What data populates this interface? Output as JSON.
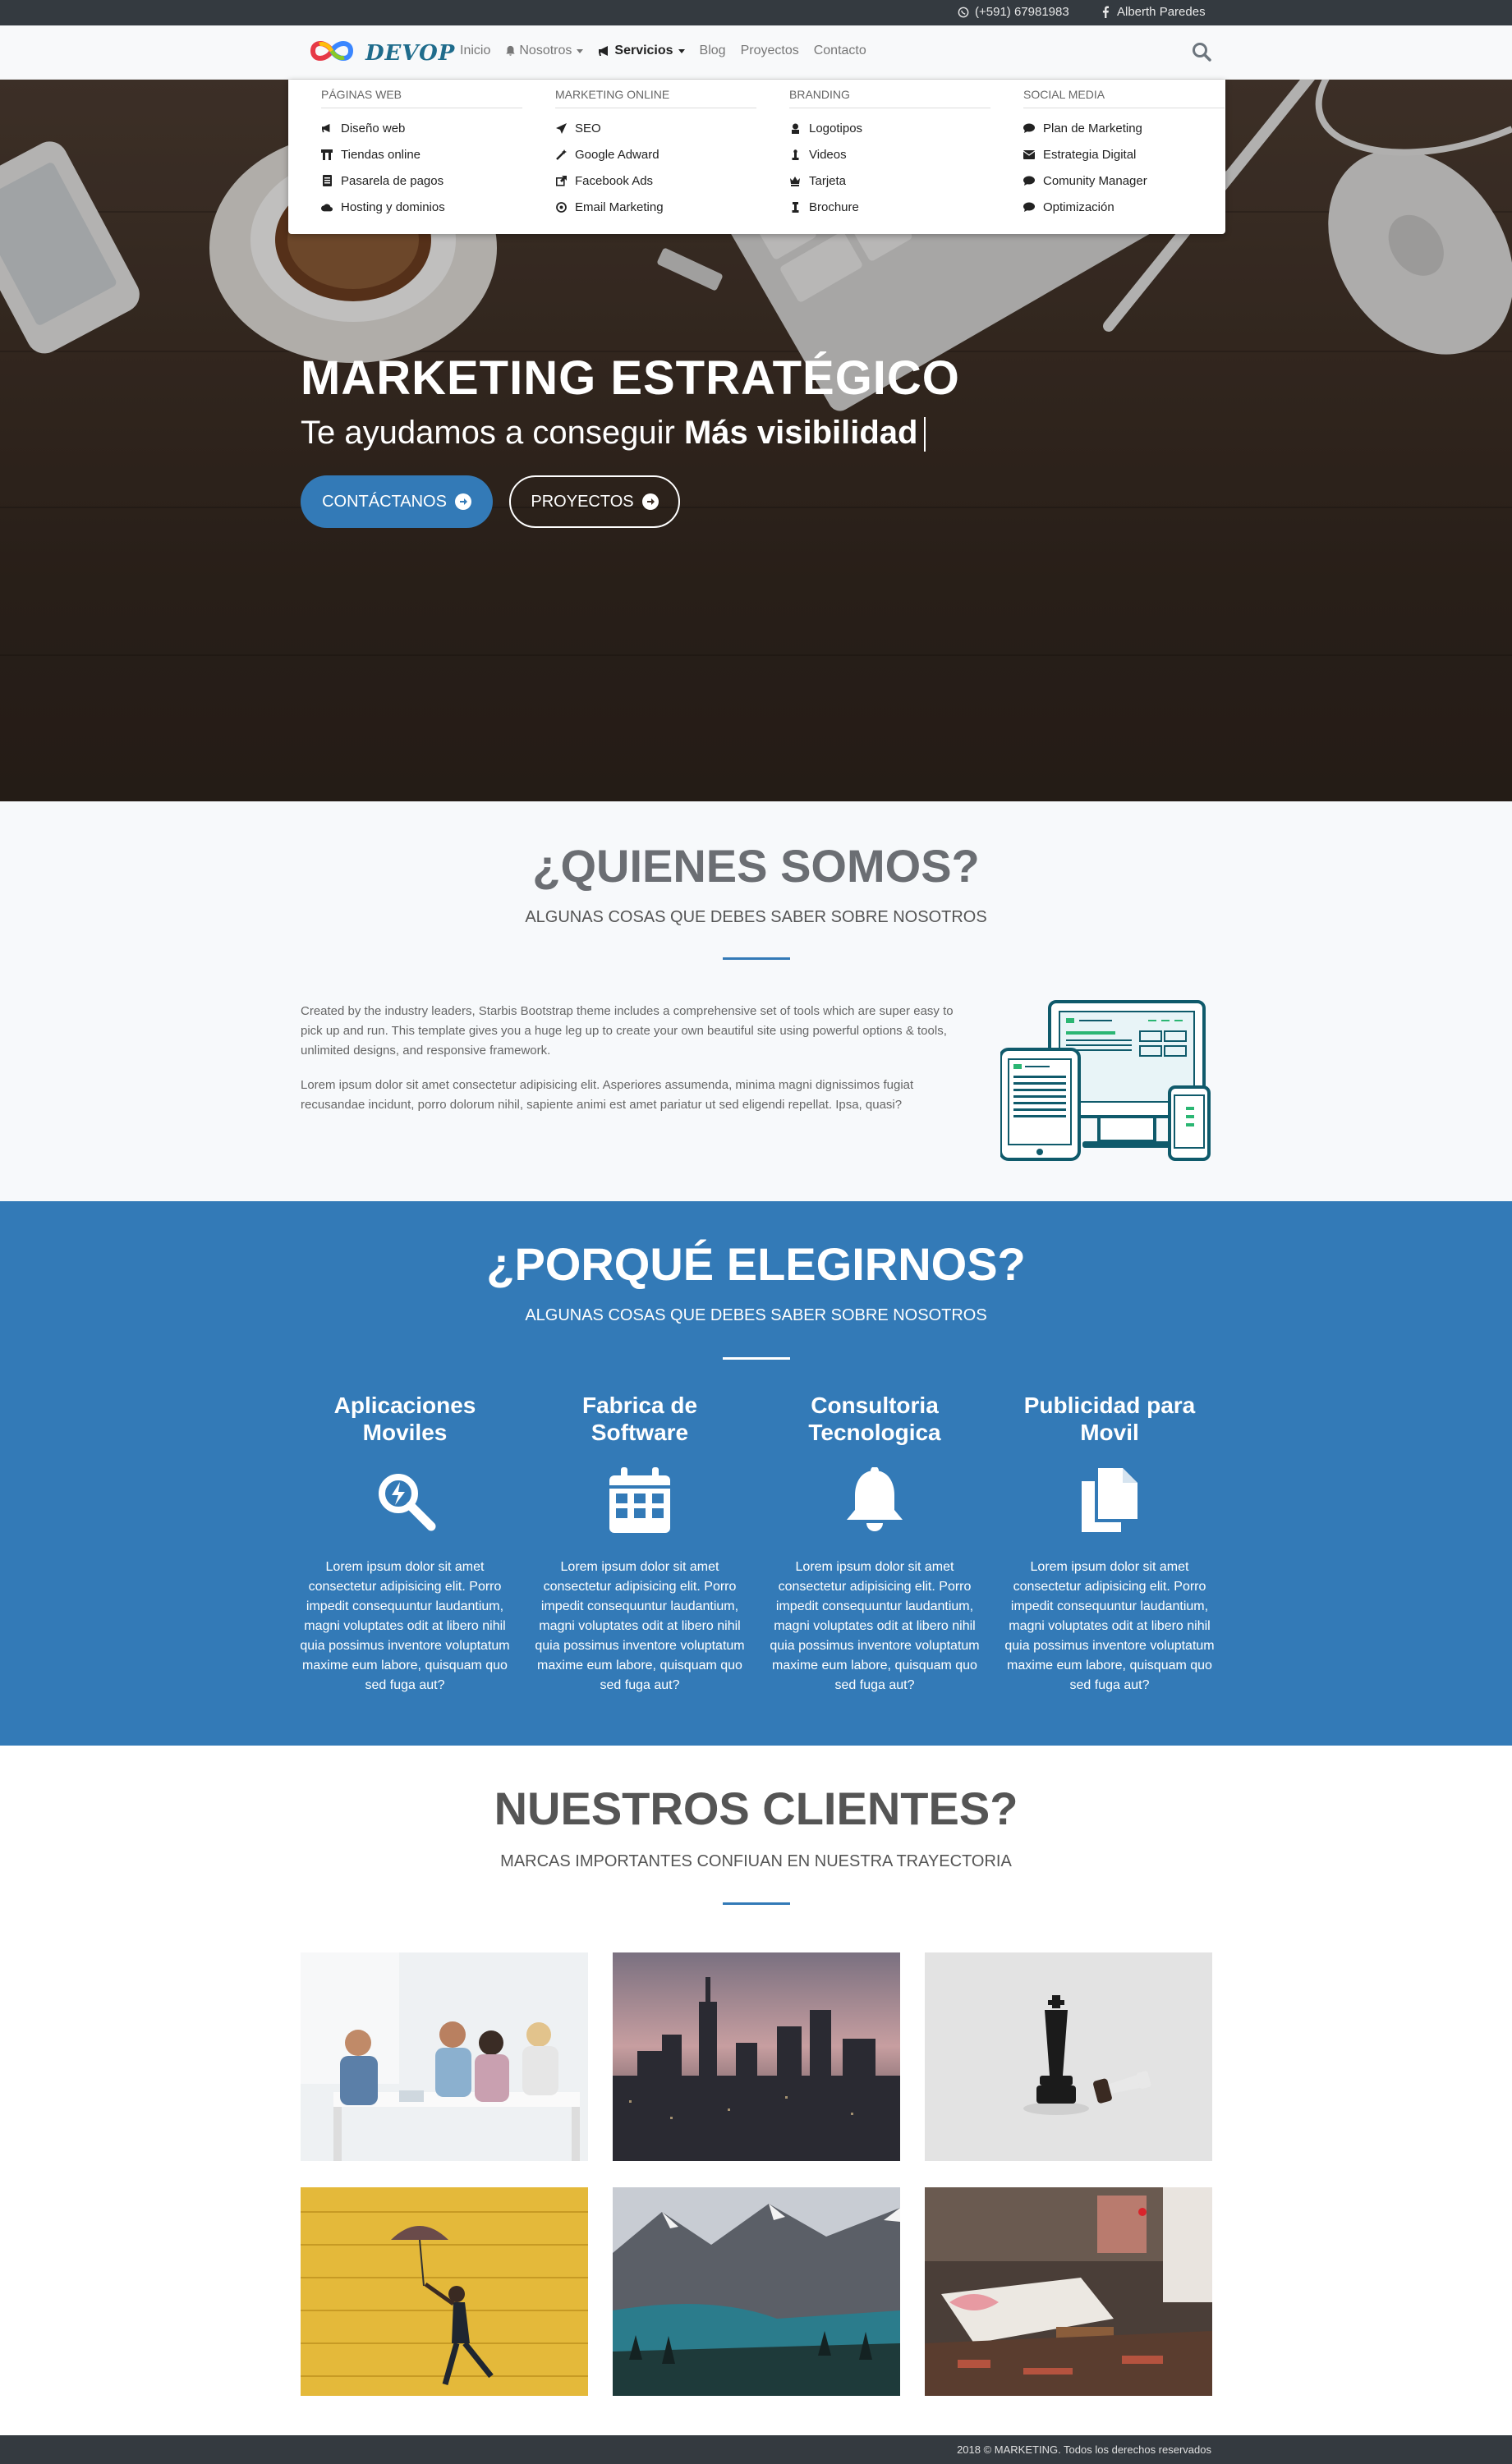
{
  "topbar": {
    "phone": "(+591) 67981983",
    "facebook_name": "Alberth Paredes"
  },
  "brand": {
    "name": "DEVOP"
  },
  "nav": {
    "items": [
      {
        "label": "Inicio",
        "dropdown": false,
        "icon": ""
      },
      {
        "label": "Nosotros",
        "dropdown": true,
        "icon": "bell-icon"
      },
      {
        "label": "Servicios",
        "dropdown": true,
        "icon": "bullhorn-icon",
        "active": true
      },
      {
        "label": "Blog",
        "dropdown": false,
        "icon": ""
      },
      {
        "label": "Proyectos",
        "dropdown": false,
        "icon": ""
      },
      {
        "label": "Contacto",
        "dropdown": false,
        "icon": ""
      }
    ]
  },
  "mega_menu": {
    "columns": [
      {
        "title": "PÁGINAS WEB",
        "items": [
          {
            "label": "Diseño web",
            "icon": "bullhorn-icon"
          },
          {
            "label": "Tiendas online",
            "icon": "store-icon"
          },
          {
            "label": "Pasarela de pagos",
            "icon": "receipt-icon"
          },
          {
            "label": "Hosting y dominios",
            "icon": "cloud-icon"
          }
        ]
      },
      {
        "title": "MARKETING ONLINE",
        "items": [
          {
            "label": "SEO",
            "icon": "send-icon"
          },
          {
            "label": "Google Adward",
            "icon": "magic-icon"
          },
          {
            "label": "Facebook Ads",
            "icon": "external-link-icon"
          },
          {
            "label": "Email Marketing",
            "icon": "at-icon"
          }
        ]
      },
      {
        "title": "BRANDING",
        "items": [
          {
            "label": "Logotipos",
            "icon": "hat-icon"
          },
          {
            "label": "Videos",
            "icon": "chess-icon"
          },
          {
            "label": "Tarjeta",
            "icon": "chess-icon"
          },
          {
            "label": "Brochure",
            "icon": "chess-icon"
          }
        ]
      },
      {
        "title": "SOCIAL MEDIA",
        "items": [
          {
            "label": "Plan de Marketing",
            "icon": "comment-icon"
          },
          {
            "label": "Estrategia Digital",
            "icon": "envelope-icon"
          },
          {
            "label": "Comunity Manager",
            "icon": "comment-icon"
          },
          {
            "label": "Optimización",
            "icon": "comment-icon"
          }
        ]
      }
    ]
  },
  "hero": {
    "title": "MARKETING ESTRATÉGICO",
    "subtitle_prefix": "Te ayudamos a conseguir",
    "subtitle_highlight": "Más visibilidad",
    "btn_contact": "CONTÁCTANOS",
    "btn_projects": "PROYECTOS"
  },
  "about": {
    "title": "¿QUIENES SOMOS?",
    "subtitle": "ALGUNAS COSAS QUE DEBES SABER SOBRE NOSOTROS",
    "p1": "Created by the industry leaders, Starbis Bootstrap theme includes a comprehensive set of tools which are super easy to pick up and run. This template gives you a huge leg up to create your own beautiful site using powerful options & tools, unlimited designs, and responsive framework.",
    "p2": "Lorem ipsum dolor sit amet consectetur adipisicing elit. Asperiores assumenda, minima magni dignissimos fugiat recusandae incidunt, porro dolorum nihil, sapiente animi est amet pariatur ut sed eligendi repellat. Ipsa, quasi?"
  },
  "why": {
    "title": "¿PORQUÉ ELEGIRNOS?",
    "subtitle": "ALGUNAS COSAS QUE DEBES SABER SOBRE NOSOTROS",
    "cards": [
      {
        "title": "Aplicaciones Moviles",
        "icon": "search-magic-icon",
        "text": "Lorem ipsum dolor sit amet consectetur adipisicing elit. Porro impedit consequuntur laudantium, magni voluptates odit at libero nihil quia possimus inventore voluptatum maxime eum labore, quisquam quo sed fuga aut?"
      },
      {
        "title": "Fabrica de Software",
        "icon": "calendar-icon",
        "text": "Lorem ipsum dolor sit amet consectetur adipisicing elit. Porro impedit consequuntur laudantium, magni voluptates odit at libero nihil quia possimus inventore voluptatum maxime eum labore, quisquam quo sed fuga aut?"
      },
      {
        "title": "Consultoria Tecnologica",
        "icon": "bell-icon",
        "text": "Lorem ipsum dolor sit amet consectetur adipisicing elit. Porro impedit consequuntur laudantium, magni voluptates odit at libero nihil quia possimus inventore voluptatum maxime eum labore, quisquam quo sed fuga aut?"
      },
      {
        "title": "Publicidad para Movil",
        "icon": "copy-icon",
        "text": "Lorem ipsum dolor sit amet consectetur adipisicing elit. Porro impedit consequuntur laudantium, magni voluptates odit at libero nihil quia possimus inventore voluptatum maxime eum labore, quisquam quo sed fuga aut?"
      }
    ]
  },
  "clients": {
    "title": "NUESTROS CLIENTES?",
    "subtitle": "MARCAS IMPORTANTES CONFIUAN EN NUESTRA TRAYECTORIA"
  },
  "footer": {
    "text": "2018 © MARKETING. Todos los derechos reservados"
  },
  "colors": {
    "primary": "#337ab7",
    "dark": "#343a40",
    "brand": "#1f6c8c"
  }
}
